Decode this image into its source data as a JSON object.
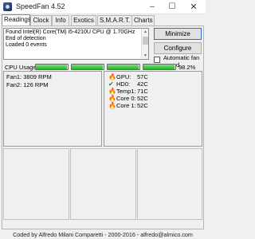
{
  "window": {
    "title": "SpeedFan 4.52",
    "controls": {
      "minimize": "–",
      "maximize": "☐",
      "close": "✕"
    }
  },
  "tabs": [
    {
      "label": "Readings",
      "active": true
    },
    {
      "label": "Clock",
      "active": false
    },
    {
      "label": "Info",
      "active": false
    },
    {
      "label": "Exotics",
      "active": false
    },
    {
      "label": "S.M.A.R.T.",
      "active": false
    },
    {
      "label": "Charts",
      "active": false
    }
  ],
  "log": {
    "lines": [
      "Found Intel(R) Core(TM) i5-4210U CPU @ 1.70GHz",
      "End of detection",
      "Loaded 0 events"
    ]
  },
  "buttons": {
    "minimize": "Minimize",
    "configure": "Configure"
  },
  "automatic_fan": {
    "label": "Automatic fan speed",
    "checked": false
  },
  "cpu_usage": {
    "label": "CPU Usage",
    "value_text": "98.2%",
    "core_levels": [
      0.98,
      0.98,
      0.98,
      0.98
    ],
    "fill_color": "#23b323"
  },
  "fans": [
    {
      "label": "Fan1: 3809 RPM"
    },
    {
      "label": "Fan2: 126 RPM"
    }
  ],
  "temperatures": [
    {
      "icon": "flame-icon",
      "name": "GPU:",
      "value": "57C"
    },
    {
      "icon": "check-icon",
      "name": "HD0:",
      "value": "42C"
    },
    {
      "icon": "flame-icon",
      "name": "Temp1:",
      "value": "71C"
    },
    {
      "icon": "flame-icon",
      "name": "Core 0:",
      "value": "52C"
    },
    {
      "icon": "flame-icon",
      "name": "Core 1:",
      "value": "52C"
    }
  ],
  "footer": "Coded by Alfredo Milani Comparetti - 2000-2016 - alfredo@almico.com"
}
